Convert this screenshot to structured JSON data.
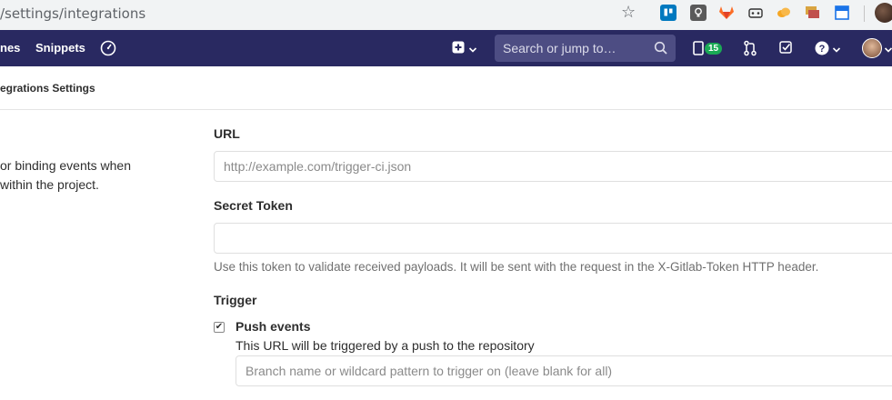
{
  "browser": {
    "url": "/settings/integrations",
    "extensions": [
      "trello-icon",
      "lightbulb-icon",
      "gitlab-icon",
      "game-icon",
      "cloud-icon",
      "stack-icon",
      "window-icon"
    ]
  },
  "nav": {
    "partial_link": "nes",
    "snippets": "Snippets",
    "search_placeholder": "Search or jump to…",
    "todo_count": "15"
  },
  "breadcrumb": "egrations Settings",
  "description": "or binding events when within the project.",
  "form": {
    "url_label": "URL",
    "url_placeholder": "http://example.com/trigger-ci.json",
    "token_label": "Secret Token",
    "token_value": "",
    "token_help": "Use this token to validate received payloads. It will be sent with the request in the X-Gitlab-Token HTTP header.",
    "trigger_label": "Trigger",
    "push_label": "Push events",
    "push_checked": true,
    "push_description": "This URL will be triggered by a push to the repository",
    "branch_placeholder": "Branch name or wildcard pattern to trigger on (leave blank for all)"
  },
  "colors": {
    "navbar": "#292961",
    "search": "#4d4d83",
    "badge": "#1aaa55"
  }
}
